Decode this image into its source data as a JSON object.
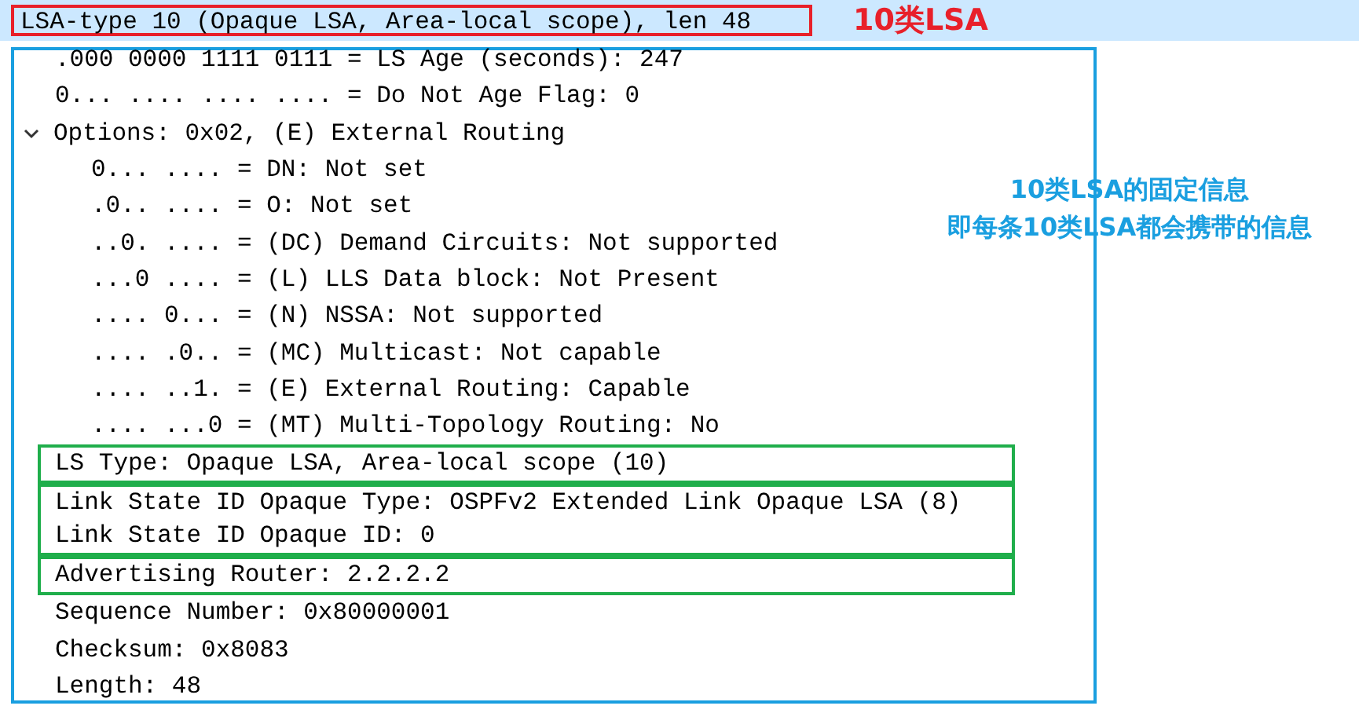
{
  "header": {
    "text": "LSA-type 10 (Opaque LSA, Area-local scope), len 48",
    "selected": true,
    "annotation": "10类LSA"
  },
  "details": {
    "annotation": [
      "10类LSA的固定信息",
      "即每条10类LSA都会携带的信息"
    ],
    "fields": [
      {
        "kind": "field",
        "text": ".000 0000 1111 0111 = LS Age (seconds): 247"
      },
      {
        "kind": "field",
        "text": "0... .... .... .... = Do Not Age Flag: 0"
      },
      {
        "kind": "tree",
        "text": "Options: 0x02, (E) External Routing",
        "expanded": true,
        "children": [
          {
            "text": "0... .... = DN: Not set"
          },
          {
            "text": ".0.. .... = O: Not set"
          },
          {
            "text": "..0. .... = (DC) Demand Circuits: Not supported"
          },
          {
            "text": "...0 .... = (L) LLS Data block: Not Present"
          },
          {
            "text": ".... 0... = (N) NSSA: Not supported"
          },
          {
            "text": ".... .0.. = (MC) Multicast: Not capable"
          },
          {
            "text": ".... ..1. = (E) External Routing: Capable"
          },
          {
            "text": ".... ...0 = (MT) Multi-Topology Routing: No"
          }
        ]
      },
      {
        "kind": "box",
        "items": [
          {
            "text": "LS Type: Opaque LSA, Area-local scope (10)"
          }
        ]
      },
      {
        "kind": "box",
        "items": [
          {
            "text": "Link State ID Opaque Type: OSPFv2 Extended Link Opaque LSA (8)"
          },
          {
            "text": "Link State ID Opaque ID: 0"
          }
        ]
      },
      {
        "kind": "box",
        "items": [
          {
            "text": "Advertising Router: 2.2.2.2"
          }
        ]
      },
      {
        "kind": "field",
        "text": "Sequence Number: 0x80000001"
      },
      {
        "kind": "field",
        "text": "Checksum: 0x8083"
      },
      {
        "kind": "field",
        "text": "Length: 48"
      }
    ]
  }
}
